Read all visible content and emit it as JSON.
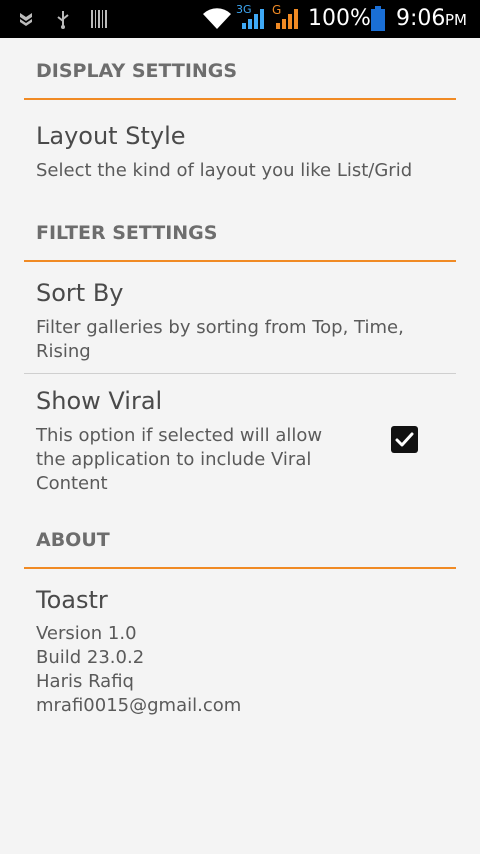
{
  "status_bar": {
    "battery_percent": "100%",
    "time": "9:06",
    "time_suffix": "PM",
    "network_3g": "3G",
    "network_g": "G",
    "icons": [
      "notification-icon",
      "usb-icon",
      "barcode-icon",
      "wifi-icon",
      "signal-3g-icon",
      "signal-g-icon",
      "battery-icon"
    ]
  },
  "display_settings": {
    "header": "DISPLAY SETTINGS",
    "layout_style": {
      "title": "Layout Style",
      "summary": "Select the kind of layout you like List/Grid"
    }
  },
  "filter_settings": {
    "header": "FILTER SETTINGS",
    "sort_by": {
      "title": "Sort By",
      "summary_line1": "Filter galleries by sorting from  Top, Time,",
      "summary_line2": "Rising"
    },
    "show_viral": {
      "title": "Show Viral",
      "summary_line1": "This option if selected will allow",
      "summary_line2": "the application to include Viral",
      "summary_line3": "Content",
      "checked": true
    }
  },
  "about": {
    "header": "ABOUT",
    "app_name": "Toastr",
    "version": "Version 1.0",
    "build": "Build 23.0.2",
    "author": "Haris Rafiq",
    "email": "mrafi0015@gmail.com"
  },
  "colors": {
    "accent": "#f08a24",
    "status_bar": "#000000",
    "background": "#f4f4f4",
    "battery": "#1a6fd6"
  }
}
